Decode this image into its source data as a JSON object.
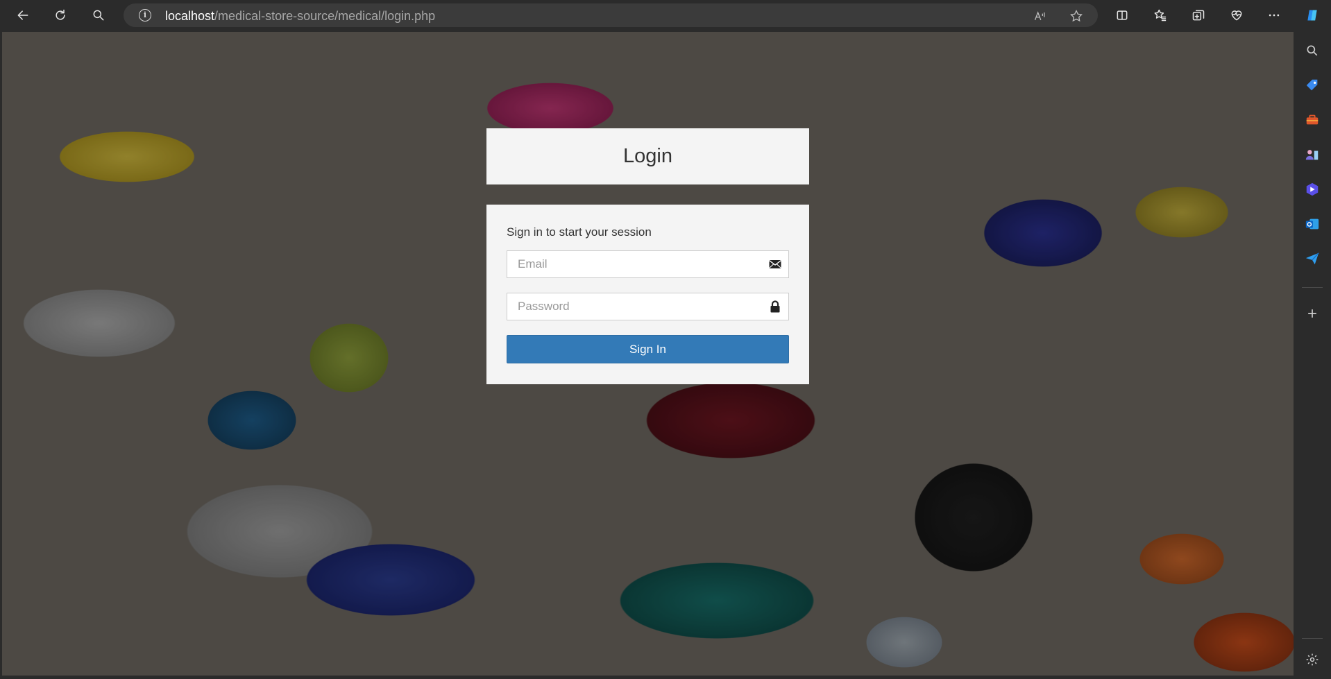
{
  "browser": {
    "url_host": "localhost",
    "url_path": "/medical-store-source/medical/login.php",
    "toolbar_icons": [
      "back-icon",
      "refresh-icon",
      "search-icon",
      "read-aloud-icon",
      "favorite-star-icon",
      "split-screen-icon",
      "favorites-icon",
      "collections-icon",
      "browser-essentials-icon",
      "more-icon",
      "copilot-icon"
    ],
    "sidebar_icons": [
      "search-icon",
      "shopping-tag-icon",
      "tools-icon",
      "games-icon",
      "copilot-app-icon",
      "outlook-icon",
      "send-icon",
      "add-icon",
      "settings-icon"
    ]
  },
  "login": {
    "title": "Login",
    "message": "Sign in to start your session",
    "email_placeholder": "Email",
    "password_placeholder": "Password",
    "submit_label": "Sign In"
  },
  "colors": {
    "primary_button": "#337ab7",
    "card_background": "#f4f4f4",
    "browser_chrome": "#2b2b2b"
  }
}
